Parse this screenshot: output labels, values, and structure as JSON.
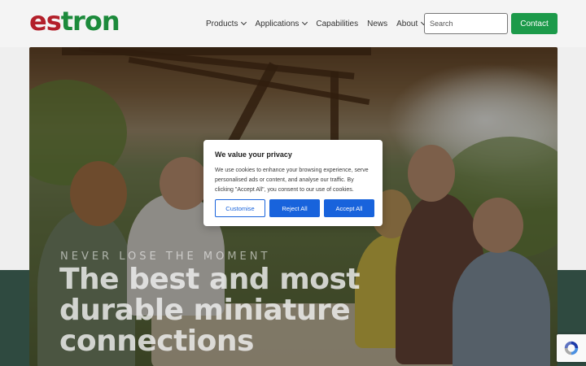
{
  "header": {
    "logo_part1": "es",
    "logo_part2": "tron",
    "nav": {
      "products": "Products",
      "applications": "Applications",
      "capabilities": "Capabilities",
      "news": "News",
      "about": "About"
    },
    "search_placeholder": "Search",
    "contact_label": "Contact"
  },
  "hero": {
    "eyebrow": "NEVER LOSE THE MOMENT",
    "headline": "The best and most durable miniature connections"
  },
  "cookie": {
    "title": "We value your privacy",
    "text": "We use cookies to enhance your browsing experience, serve personalised ads or content, and analyse our traffic. By clicking \"Accept All\", you consent to our use of cookies.",
    "customise": "Customise",
    "reject": "Reject All",
    "accept": "Accept All"
  },
  "colors": {
    "brand_red": "#b3202a",
    "brand_green": "#1c8a3b",
    "contact_green": "#1c9a4a",
    "cookie_blue": "#1863dc",
    "band": "#2f4a40"
  },
  "icons": {
    "recaptcha": "recaptcha-icon"
  }
}
